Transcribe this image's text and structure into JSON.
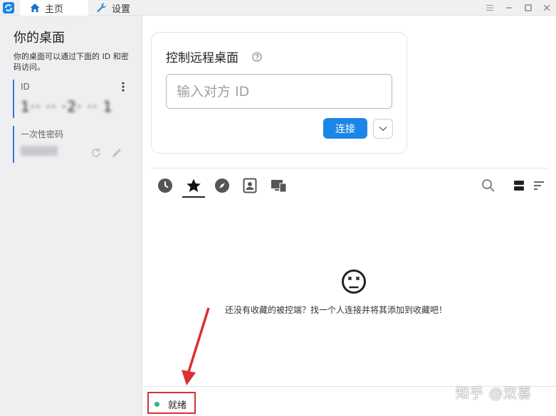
{
  "titlebar": {
    "tabs": [
      {
        "label": "主页",
        "icon": "home-icon"
      },
      {
        "label": "设置",
        "icon": "wrench-icon"
      }
    ],
    "controls": [
      "menu-icon",
      "minimize-icon",
      "maximize-icon",
      "close-icon"
    ]
  },
  "sidebar": {
    "title": "你的桌面",
    "description": "你的桌面可以通过下面的 ID 和密码访问。",
    "id_label": "ID",
    "id_value": "1·· ·· ·2· ·· 1",
    "password_label": "一次性密码",
    "password_value": ""
  },
  "connect": {
    "title": "控制远程桌面",
    "placeholder": "输入对方 ID",
    "button": "连接"
  },
  "peers": {
    "tabs": [
      "recent-icon",
      "favorites-icon",
      "discovered-icon",
      "address-book-icon",
      "group-icon"
    ],
    "active_tab": "favorites-icon",
    "empty_message": "还没有收藏的被控端？找一个人连接并将其添加到收藏吧！"
  },
  "status": {
    "text": "就绪",
    "color": "#2fb584"
  },
  "watermark": "知乎 @双喜",
  "colors": {
    "accent": "#1c86e8",
    "annotation": "#d93030"
  }
}
